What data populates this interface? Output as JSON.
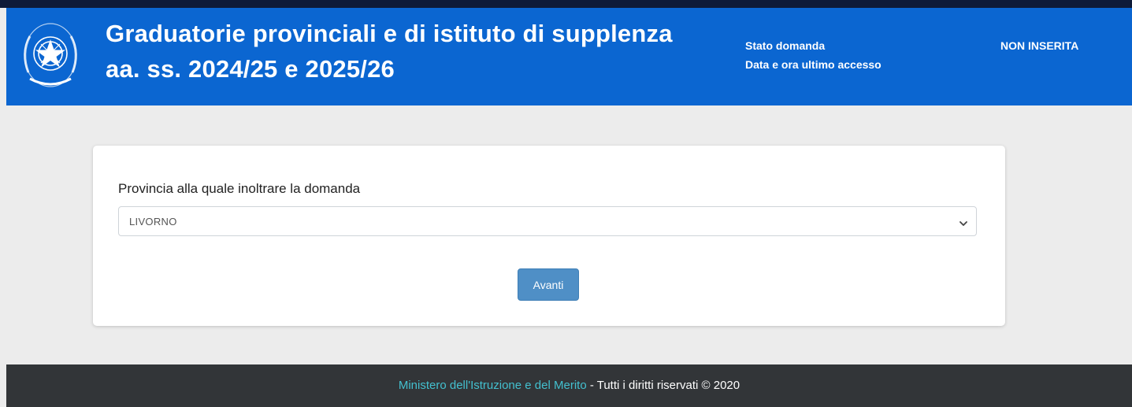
{
  "header": {
    "title_line1": "Graduatorie provinciali e di istituto di supplenza",
    "title_line2": "aa. ss. 2024/25 e 2025/26",
    "status_label": "Stato domanda",
    "last_access_label": "Data e ora ultimo accesso",
    "status_value": "NON INSERITA",
    "logo_icon": "italian-republic-emblem-icon"
  },
  "form": {
    "province_label": "Provincia alla quale inoltrare la domanda",
    "province_selected": "LIVORNO",
    "next_label": "Avanti"
  },
  "footer": {
    "ministry_link": "Ministero dell'Istruzione e del Merito",
    "rights_text": " - Tutti i diritti riservati © 2020"
  },
  "colors": {
    "header_bg": "#0b66d1",
    "footer_bg": "#323538",
    "button_bg": "#4f8fc6",
    "link": "#43c0cf"
  }
}
